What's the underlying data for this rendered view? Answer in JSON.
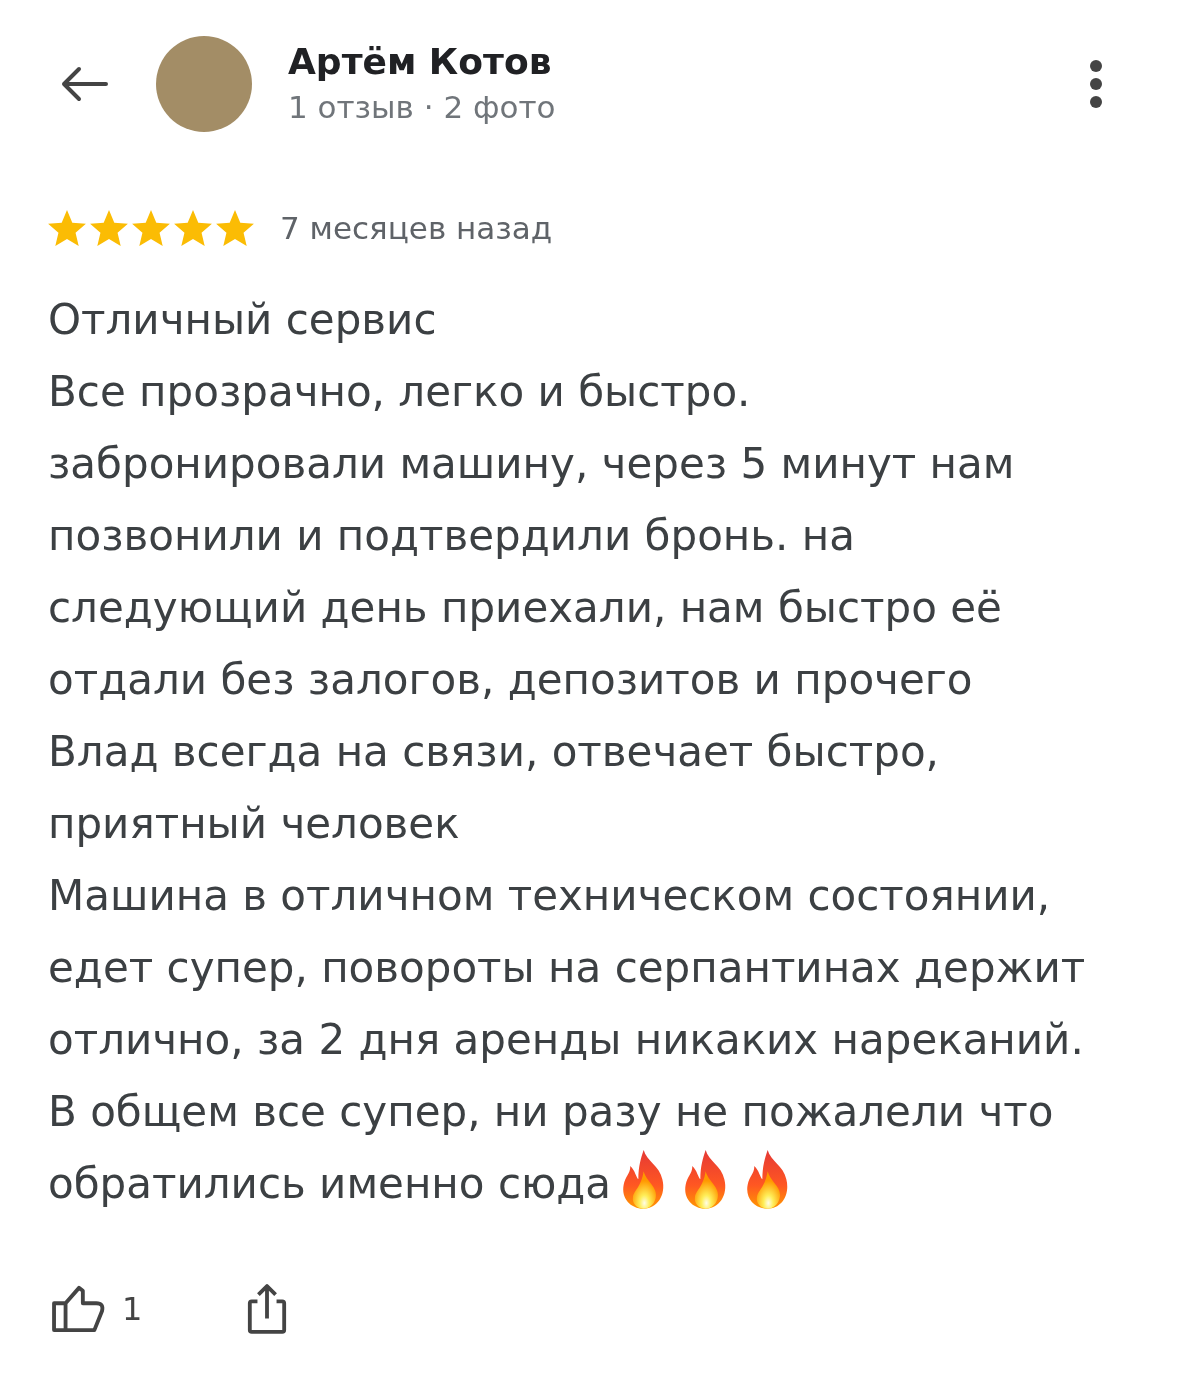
{
  "header": {
    "author": "Артём Котов",
    "meta": "1 отзыв · 2 фото"
  },
  "review": {
    "stars": 5,
    "time": "7 месяцев назад",
    "paragraphs": [
      "Отличный сервис",
      "Все прозрачно, легко и быстро.",
      "забронировали машину, через 5 минут нам позвонили и подтвердили бронь. на следующий день приехали, нам быстро её отдали без залогов, депозитов и прочего",
      "Влад всегда на связи, отвечает быстро, приятный человек",
      "Машина в отличном техническом состоянии, едет супер, повороты на серпантинах держит отлично, за 2 дня аренды никаких нареканий."
    ],
    "closing_lines": [
      "В общем все супер, ни разу не пожалели что",
      "обратились именно сюда"
    ],
    "trailing_icons": [
      {
        "kind": "fire"
      },
      {
        "kind": "fire"
      },
      {
        "kind": "fire"
      }
    ]
  },
  "actions": {
    "likes": "1"
  }
}
